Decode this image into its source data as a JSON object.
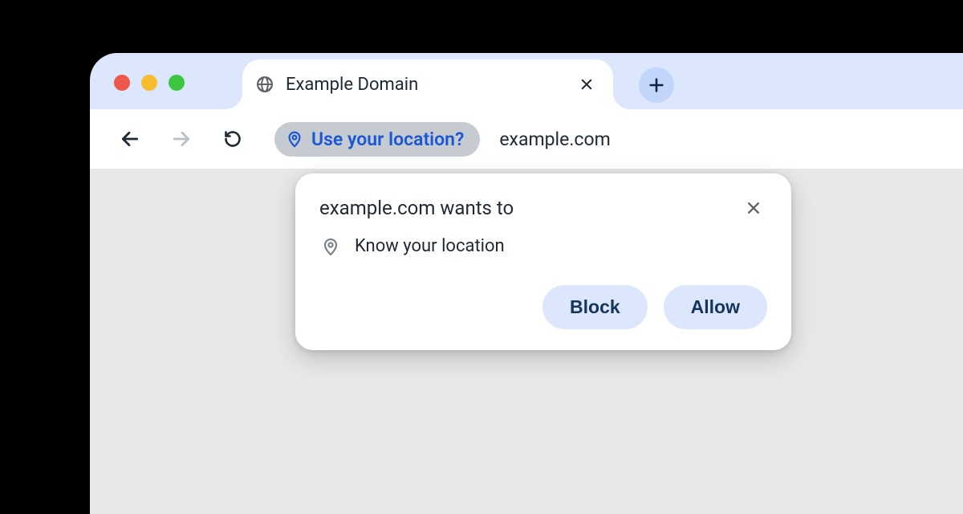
{
  "tab": {
    "title": "Example Domain"
  },
  "toolbar": {
    "permission_chip_label": "Use your location?",
    "address": "example.com"
  },
  "popup": {
    "title": "example.com wants to",
    "permission_item": "Know your location",
    "block_label": "Block",
    "allow_label": "Allow"
  }
}
